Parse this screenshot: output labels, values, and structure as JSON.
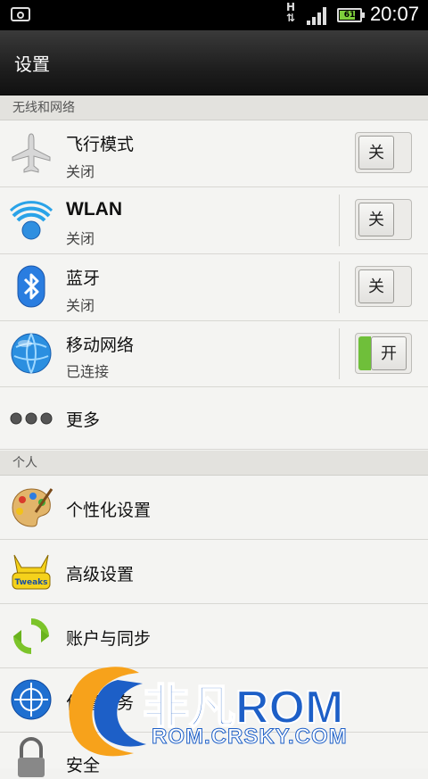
{
  "status_bar": {
    "network_type": "H",
    "battery_level": "61",
    "time": "20:07"
  },
  "title": "设置",
  "sections": [
    {
      "header": "无线和网络",
      "items": [
        {
          "label": "飞行模式",
          "sub": "关闭",
          "toggle": "关",
          "icon": "airplane-icon"
        },
        {
          "label": "WLAN",
          "sub": "关闭",
          "toggle": "关",
          "icon": "wifi-icon"
        },
        {
          "label": "蓝牙",
          "sub": "关闭",
          "toggle": "关",
          "icon": "bluetooth-icon"
        },
        {
          "label": "移动网络",
          "sub": "已连接",
          "toggle": "开",
          "icon": "globe-icon"
        },
        {
          "label": "更多",
          "icon": "more-dots-icon"
        }
      ]
    },
    {
      "header": "个人",
      "items": [
        {
          "label": "个性化设置",
          "icon": "palette-icon"
        },
        {
          "label": "高级设置",
          "icon": "tweaks-icon"
        },
        {
          "label": "账户与同步",
          "icon": "sync-icon"
        },
        {
          "label": "位置服务",
          "icon": "location-globe-icon"
        },
        {
          "label": "安全",
          "icon": "lock-icon"
        }
      ]
    }
  ],
  "watermark": {
    "brand": "非凡ROM",
    "url": "ROM.CRSKY.COM",
    "colors": {
      "blue": "#1d5fc7",
      "green": "#7fd22b",
      "orange": "#f7a21b"
    }
  }
}
